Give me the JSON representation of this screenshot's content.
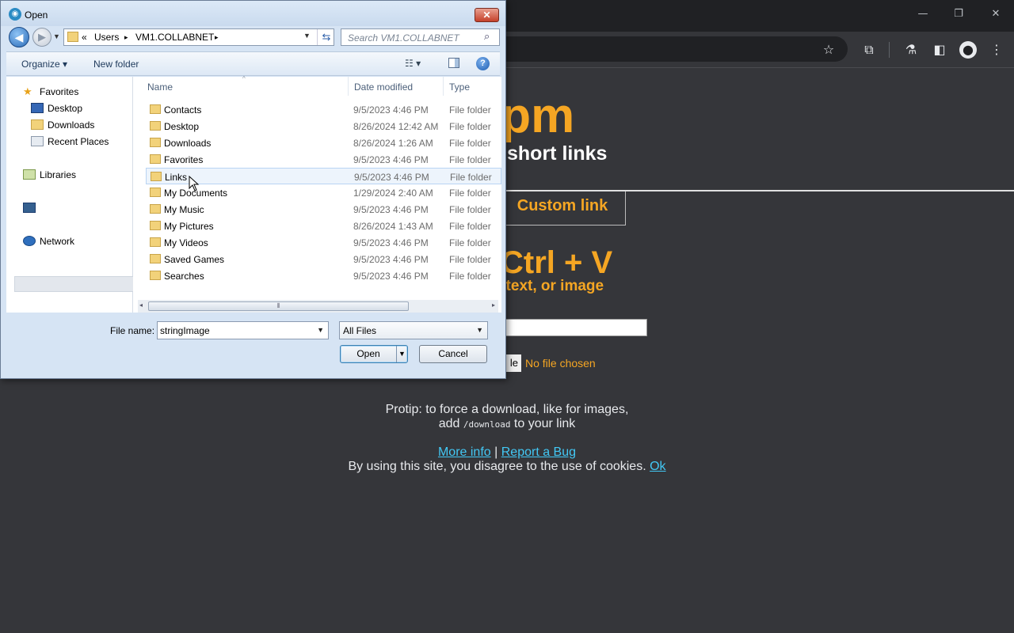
{
  "browser": {
    "window_controls": [
      "—",
      "❐",
      "✕"
    ],
    "toolbar_icons": [
      "star-icon",
      "extensions-icon",
      "labs-icon",
      "sidepanel-icon",
      "profile-icon",
      "menu-icon"
    ]
  },
  "page": {
    "site_title_partial": ".pm",
    "site_subtitle_partial": "short links",
    "tab_custom_link": "Custom link",
    "heading_partial": "Ctrl + V",
    "subheading_partial": ", text, or image",
    "file_button_partial": "le",
    "file_status": "No file chosen",
    "protip_line1": "Protip: to force a download, like for images,",
    "protip_add": "add",
    "protip_code": "/download",
    "protip_end": "to your link",
    "more_info": "More info",
    "separator": "|",
    "report_bug": "Report a Bug",
    "cookie_text": "By using this site, you disagree to the use of cookies.",
    "cookie_ok": "Ok",
    "accent_color": "#f5a623",
    "link_color": "#42c8f5"
  },
  "dialog": {
    "title": "Open",
    "close": "✕",
    "breadcrumb": {
      "chevrons": "«",
      "users": "Users",
      "arrow": "▸",
      "folder": "VM1.COLLABNET"
    },
    "search_placeholder": "Search VM1.COLLABNET",
    "commands": {
      "organize": "Organize ▾",
      "new_folder": "New folder",
      "help": "?"
    },
    "nav": {
      "favorites": "Favorites",
      "desktop": "Desktop",
      "downloads": "Downloads",
      "recent_places": "Recent Places",
      "libraries": "Libraries",
      "network": "Network"
    },
    "columns": {
      "name": "Name",
      "date_modified": "Date modified",
      "type": "Type"
    },
    "files": [
      {
        "name": "Contacts",
        "date": "9/5/2023 4:46 PM",
        "type": "File folder"
      },
      {
        "name": "Desktop",
        "date": "8/26/2024 12:42 AM",
        "type": "File folder"
      },
      {
        "name": "Downloads",
        "date": "8/26/2024 1:26 AM",
        "type": "File folder"
      },
      {
        "name": "Favorites",
        "date": "9/5/2023 4:46 PM",
        "type": "File folder"
      },
      {
        "name": "Links",
        "date": "9/5/2023 4:46 PM",
        "type": "File folder"
      },
      {
        "name": "My Documents",
        "date": "1/29/2024 2:40 AM",
        "type": "File folder"
      },
      {
        "name": "My Music",
        "date": "9/5/2023 4:46 PM",
        "type": "File folder"
      },
      {
        "name": "My Pictures",
        "date": "8/26/2024 1:43 AM",
        "type": "File folder"
      },
      {
        "name": "My Videos",
        "date": "9/5/2023 4:46 PM",
        "type": "File folder"
      },
      {
        "name": "Saved Games",
        "date": "9/5/2023 4:46 PM",
        "type": "File folder"
      },
      {
        "name": "Searches",
        "date": "9/5/2023 4:46 PM",
        "type": "File folder"
      }
    ],
    "file_name_label": "File name:",
    "file_name_value": "stringImage",
    "file_type_filter": "All Files",
    "open_button": "Open",
    "cancel_button": "Cancel"
  }
}
